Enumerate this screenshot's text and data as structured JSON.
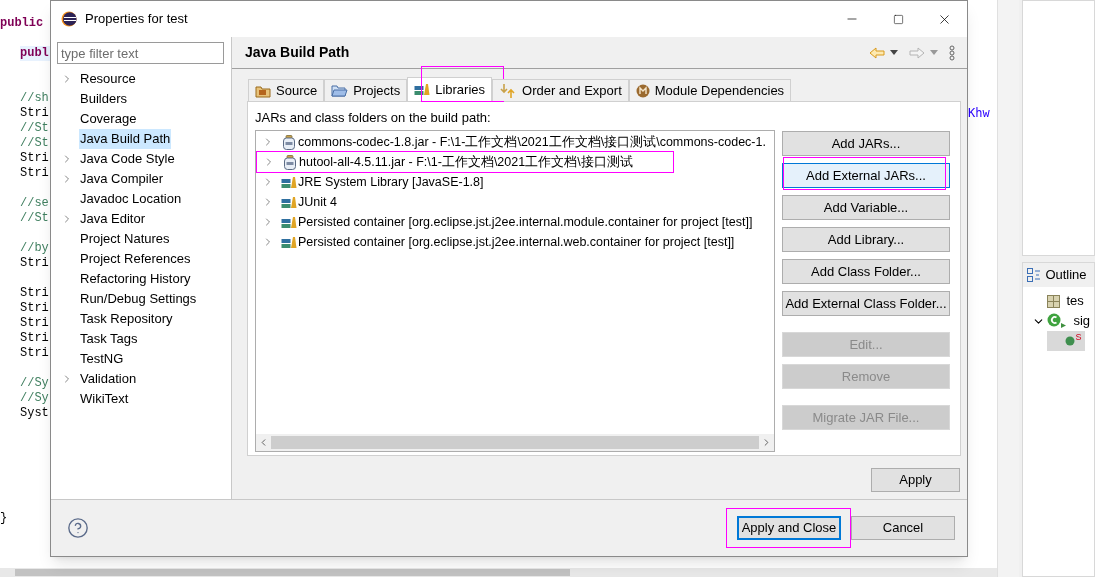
{
  "editor": {
    "blocks": [
      [
        {
          "kind": "declaration",
          "text": "public",
          "current": false
        }
      ],
      [
        {
          "kind": "method",
          "text": "publ",
          "current": true
        }
      ],
      [
        {
          "kind": "comment",
          "text": "//sh",
          "current": false
        },
        {
          "kind": "code",
          "text": "Stri",
          "current": false
        },
        {
          "kind": "comment",
          "text": "//St",
          "current": false
        },
        {
          "kind": "comment",
          "text": "//St",
          "current": false
        },
        {
          "kind": "code",
          "text": "Stri",
          "current": false
        },
        {
          "kind": "code",
          "text": "Stri",
          "current": false
        }
      ],
      [
        {
          "kind": "comment",
          "text": "//se",
          "current": false
        },
        {
          "kind": "comment",
          "text": "//St",
          "current": false
        }
      ],
      [
        {
          "kind": "comment",
          "text": "//by",
          "current": false
        },
        {
          "kind": "code",
          "text": "Stri",
          "current": false
        }
      ],
      [
        {
          "kind": "code",
          "text": "Stri",
          "current": false
        },
        {
          "kind": "code",
          "text": "Stri",
          "current": false
        },
        {
          "kind": "code",
          "text": "Stri",
          "current": false
        },
        {
          "kind": "code",
          "text": "Stri",
          "current": false
        },
        {
          "kind": "code",
          "text": "Stri",
          "current": false
        }
      ],
      [
        {
          "kind": "comment",
          "text": "//Sy",
          "current": false
        },
        {
          "kind": "comment",
          "text": "//Sy",
          "current": false
        },
        {
          "kind": "code",
          "text": "Syst",
          "current": false
        }
      ],
      [
        {
          "kind": "brace",
          "text": "}",
          "current": false
        }
      ]
    ],
    "fragment": "Khw"
  },
  "outline": {
    "title": "Outline",
    "items": [
      {
        "kind": "import",
        "label": "tes",
        "selected": false
      },
      {
        "kind": "class",
        "label": "sig",
        "expanded": true,
        "selected": false,
        "children": [
          {
            "kind": "field",
            "label": "S",
            "selected": true
          }
        ]
      }
    ]
  },
  "dialog": {
    "title": "Properties for test",
    "filter": {
      "placeholder": "type filter text"
    },
    "nav": [
      {
        "label": "Resource",
        "expandable": true,
        "selected": false
      },
      {
        "label": "Builders",
        "expandable": false,
        "selected": false
      },
      {
        "label": "Coverage",
        "expandable": false,
        "selected": false
      },
      {
        "label": "Java Build Path",
        "expandable": false,
        "selected": true
      },
      {
        "label": "Java Code Style",
        "expandable": true,
        "selected": false
      },
      {
        "label": "Java Compiler",
        "expandable": true,
        "selected": false
      },
      {
        "label": "Javadoc Location",
        "expandable": false,
        "selected": false
      },
      {
        "label": "Java Editor",
        "expandable": true,
        "selected": false
      },
      {
        "label": "Project Natures",
        "expandable": false,
        "selected": false
      },
      {
        "label": "Project References",
        "expandable": false,
        "selected": false
      },
      {
        "label": "Refactoring History",
        "expandable": false,
        "selected": false
      },
      {
        "label": "Run/Debug Settings",
        "expandable": false,
        "selected": false
      },
      {
        "label": "Task Repository",
        "expandable": false,
        "selected": false
      },
      {
        "label": "Task Tags",
        "expandable": false,
        "selected": false
      },
      {
        "label": "TestNG",
        "expandable": false,
        "selected": false
      },
      {
        "label": "Validation",
        "expandable": true,
        "selected": false
      },
      {
        "label": "WikiText",
        "expandable": false,
        "selected": false
      }
    ],
    "page_title": "Java Build Path",
    "tabs": [
      {
        "kind": "source",
        "label": "Source",
        "selected": false,
        "annotated": false
      },
      {
        "kind": "projects",
        "label": "Projects",
        "selected": false,
        "annotated": false
      },
      {
        "kind": "libraries",
        "label": "Libraries",
        "selected": true,
        "annotated": true
      },
      {
        "kind": "order",
        "label": "Order and Export",
        "selected": false,
        "annotated": false
      },
      {
        "kind": "module",
        "label": "Module Dependencies",
        "selected": false,
        "annotated": false
      }
    ],
    "list_label": "JARs and class folders on the build path:",
    "entries": [
      {
        "kind": "jar",
        "text": "commons-codec-1.8.jar - F:\\1-工作文档\\2021工作文档\\接口测试\\commons-codec-1.",
        "expanded": false,
        "annotated": false
      },
      {
        "kind": "jar",
        "text": "hutool-all-4.5.11.jar - F:\\1-工作文档\\2021工作文档\\接口测试",
        "expanded": false,
        "annotated": true
      },
      {
        "kind": "library",
        "text": "JRE System Library [JavaSE-1.8]",
        "expanded": false,
        "annotated": false
      },
      {
        "kind": "library",
        "text": "JUnit 4",
        "expanded": false,
        "annotated": false
      },
      {
        "kind": "library",
        "text": "Persisted container [org.eclipse.jst.j2ee.internal.module.container for project [test]]",
        "expanded": false,
        "annotated": false
      },
      {
        "kind": "library",
        "text": "Persisted container [org.eclipse.jst.j2ee.internal.web.container for project [test]]",
        "expanded": false,
        "annotated": false
      }
    ],
    "button_groups": [
      [
        {
          "label": "Add JARs...",
          "disabled": false,
          "focused": false,
          "annotated": false
        },
        {
          "label": "Add External JARs...",
          "disabled": false,
          "focused": true,
          "annotated": true
        },
        {
          "label": "Add Variable...",
          "disabled": false,
          "focused": false,
          "annotated": false
        },
        {
          "label": "Add Library...",
          "disabled": false,
          "focused": false,
          "annotated": false
        },
        {
          "label": "Add Class Folder...",
          "disabled": false,
          "focused": false,
          "annotated": false
        },
        {
          "label": "Add External Class Folder...",
          "disabled": false,
          "focused": false,
          "annotated": false
        }
      ],
      [
        {
          "label": "Edit...",
          "disabled": true,
          "focused": false,
          "annotated": false
        },
        {
          "label": "Remove",
          "disabled": true,
          "focused": false,
          "annotated": false
        }
      ],
      [
        {
          "label": "Migrate JAR File...",
          "disabled": true,
          "focused": false,
          "annotated": false
        }
      ]
    ],
    "apply": "Apply",
    "footer_buttons": [
      {
        "label": "Apply and Close",
        "default": true,
        "annotated": true
      },
      {
        "label": "Cancel",
        "default": false,
        "annotated": false
      }
    ]
  }
}
